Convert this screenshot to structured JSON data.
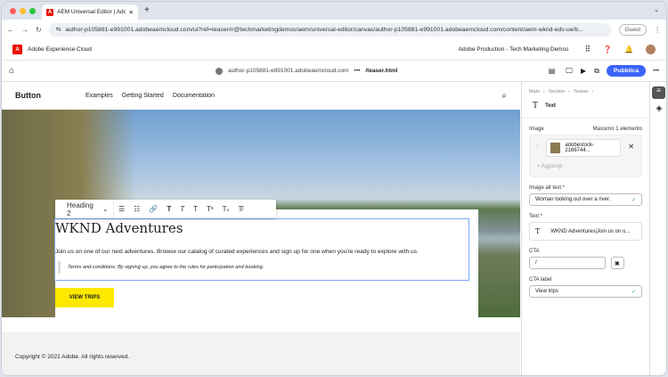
{
  "browser": {
    "tab_title": "AEM Universal Editor | Adobe",
    "url": "author-p105881-e991001.adobeaemcloud.com/ui?ref=teaser#/@techmarketingdemos/aem/universal-editor/canvas/author-p105881-e991001.adobeaemcloud.com/content/aem-wknd-eds-ue/b...",
    "guest": "Guest"
  },
  "aec": {
    "brand": "Adobe Experience Cloud",
    "org": "Adobe Production - Tech Marketing Demos"
  },
  "toolbar": {
    "host": "author-p105881-e991001.adobeaemcloud.com",
    "more": "•••",
    "path": "/teaser.html",
    "publish": "Pubblica"
  },
  "site": {
    "logo": "Button",
    "nav": [
      "Examples",
      "Getting Started",
      "Documentation"
    ]
  },
  "rte": {
    "format": "Heading 2"
  },
  "teaser": {
    "title": "WKND Adventures",
    "body": "Join us on one of our next adventures. Browse our catalog of curated experiences and sign up for one when you're ready to explore with us.",
    "terms": "Terms and conditions: By signing up, you agree to the rules for participation and booking.",
    "cta": "VIEW TRIPS"
  },
  "footer": {
    "copyright": "Copyright © 2021 Adobe. All rights reserved."
  },
  "panel": {
    "breadcrumb": [
      "Main",
      "Section",
      "Teaser"
    ],
    "component": "Text",
    "image_label": "Image",
    "image_max": "Massimo 1 elemento",
    "image_file": "adobestock-2166744...",
    "add": "Aggiungi",
    "alt_label": "Image alt text *",
    "alt_value": "Woman looking out over a river.",
    "text_label": "Text *",
    "text_value": "WKND Adventures|Join us on o...",
    "cta_label": "CTA",
    "cta_value": "/",
    "cta_label_label": "CTA label",
    "cta_label_value": "View trips"
  }
}
